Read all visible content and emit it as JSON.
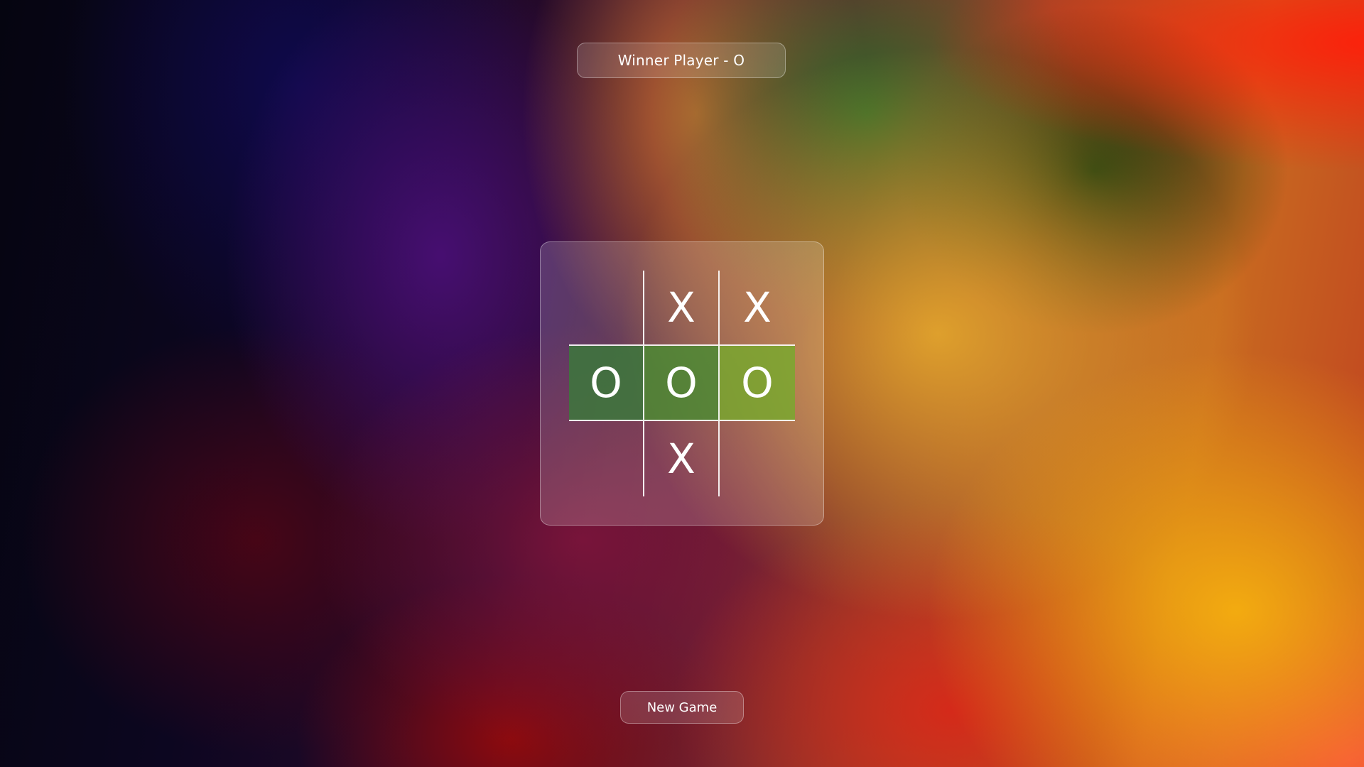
{
  "status": {
    "winner_text": "Winner Player - O"
  },
  "board": {
    "cells": [
      "",
      "X",
      "X",
      "O",
      "O",
      "O",
      "",
      "X",
      ""
    ],
    "winning_line": [
      3,
      4,
      5
    ],
    "winning_color": "#6aa83a"
  },
  "controls": {
    "new_game_label": "New Game"
  }
}
